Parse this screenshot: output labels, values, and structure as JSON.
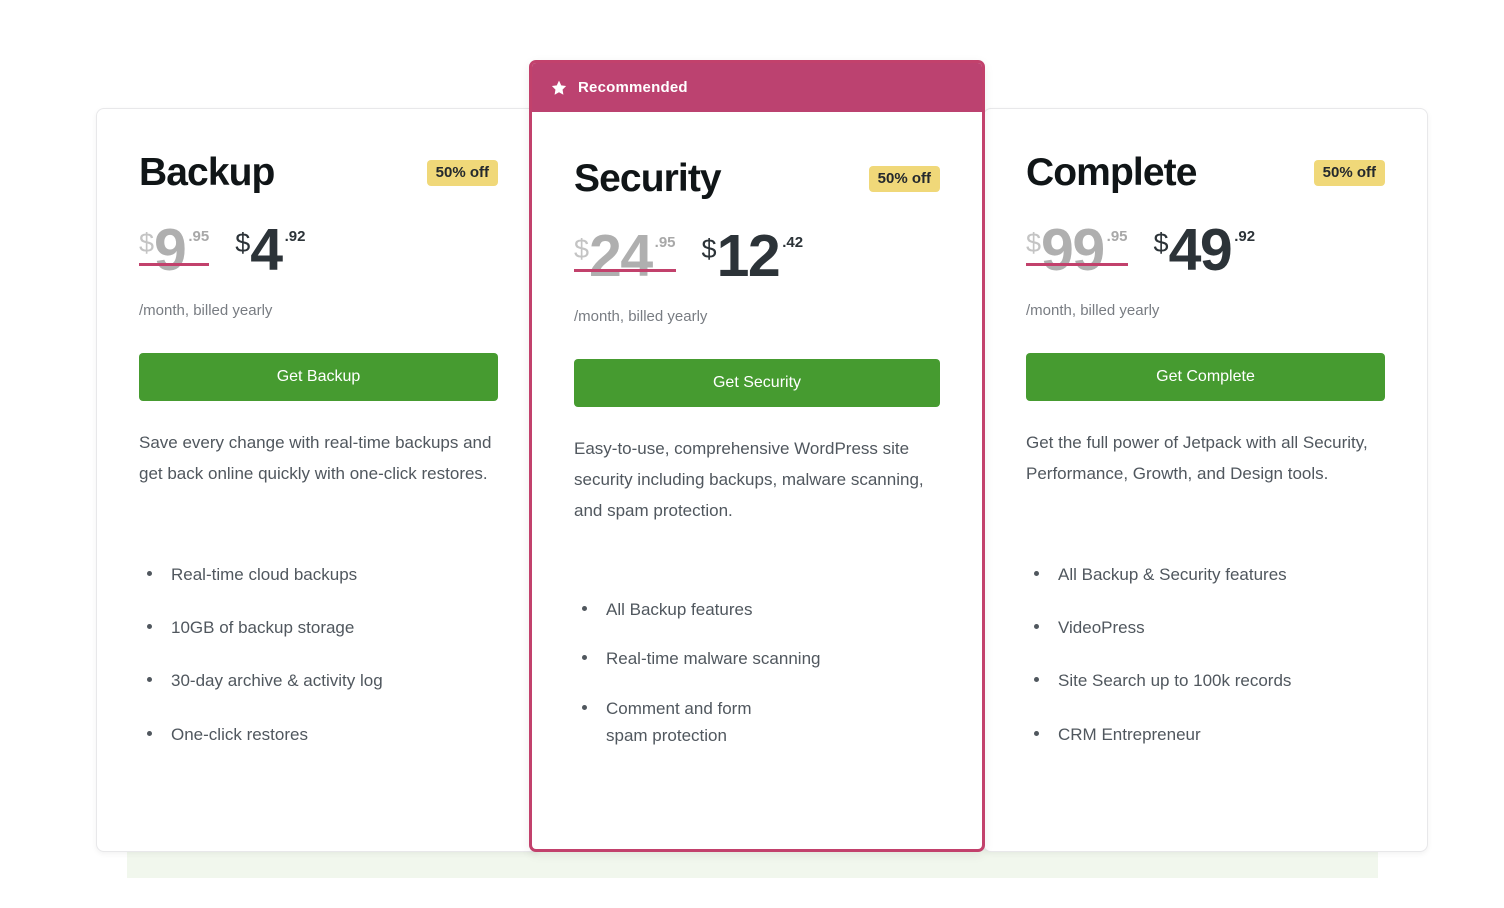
{
  "colors": {
    "accent_pink": "#bc4270",
    "featured_border": "#c2416c",
    "cta_green": "#469b30",
    "badge_yellow": "#f0d879",
    "price_dark": "#2c3338",
    "price_muted": "#afafaf",
    "band_green": "#f1f7ed"
  },
  "plans": [
    {
      "id": "backup",
      "title": "Backup",
      "discount_badge": "50% off",
      "old_price": {
        "currency": "$",
        "whole": "9",
        "cents": ".95"
      },
      "new_price": {
        "currency": "$",
        "whole": "4",
        "cents": ".92"
      },
      "billing_note": "/month, billed yearly",
      "cta_label": "Get Backup",
      "description": "Save every change with real-time backups and get back online quickly with one-click restores.",
      "features": [
        "Real-time cloud backups",
        "10GB of backup storage",
        "30-day archive & activity log",
        "One-click restores"
      ]
    },
    {
      "id": "security",
      "recommended": true,
      "ribbon_label": "Recommended",
      "ribbon_icon": "star-icon",
      "title": "Security",
      "discount_badge": "50% off",
      "old_price": {
        "currency": "$",
        "whole": "24",
        "cents": ".95"
      },
      "new_price": {
        "currency": "$",
        "whole": "12",
        "cents": ".42"
      },
      "billing_note": "/month, billed yearly",
      "cta_label": "Get Security",
      "description": "Easy-to-use, comprehensive WordPress site security including backups, malware scanning, and spam protection.",
      "features": [
        "All Backup features",
        "Real-time malware scanning",
        "Comment and form\nspam protection"
      ]
    },
    {
      "id": "complete",
      "title": "Complete",
      "discount_badge": "50% off",
      "old_price": {
        "currency": "$",
        "whole": "99",
        "cents": ".95"
      },
      "new_price": {
        "currency": "$",
        "whole": "49",
        "cents": ".92"
      },
      "billing_note": "/month, billed yearly",
      "cta_label": "Get Complete",
      "description": "Get the full power of Jetpack with all Security, Performance, Growth, and Design tools.",
      "features": [
        "All Backup & Security features",
        "VideoPress",
        "Site Search up to 100k records",
        "CRM Entrepreneur"
      ]
    }
  ]
}
